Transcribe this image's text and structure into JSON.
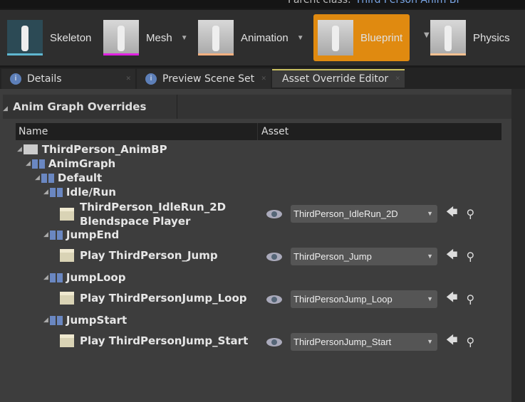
{
  "header": {
    "parent_label": "Parent class:",
    "parent_value": "Third Person Anim BP"
  },
  "toolbar": [
    {
      "label": "Skeleton",
      "color": "#5fb7d0"
    },
    {
      "label": "Mesh",
      "color": "#e020e0"
    },
    {
      "label": "Animation",
      "color": "#f5b080"
    },
    {
      "label": "Blueprint",
      "color": "#e08a10"
    },
    {
      "label": "Physics",
      "color": "#f5c090"
    }
  ],
  "tabs": [
    {
      "label": "Details"
    },
    {
      "label": "Preview Scene Set"
    },
    {
      "label": "Asset Override Editor"
    }
  ],
  "category": "Anim Graph Overrides",
  "columns": {
    "name": "Name",
    "asset": "Asset"
  },
  "tree": {
    "root": "ThirdPerson_AnimBP",
    "graph": "AnimGraph",
    "default": "Default",
    "idle": "Idle/Run",
    "idle_node1": "ThirdPerson_IdleRun_2D",
    "idle_node2": "Blendspace Player",
    "jumpend": "JumpEnd",
    "jumpend_node": "Play ThirdPerson_Jump",
    "jumploop": "JumpLoop",
    "jumploop_node": "Play ThirdPersonJump_Loop",
    "jumpstart": "JumpStart",
    "jumpstart_node": "Play ThirdPersonJump_Start"
  },
  "assets": [
    "ThirdPerson_IdleRun_2D",
    "ThirdPerson_Jump",
    "ThirdPersonJump_Loop",
    "ThirdPersonJump_Start"
  ]
}
